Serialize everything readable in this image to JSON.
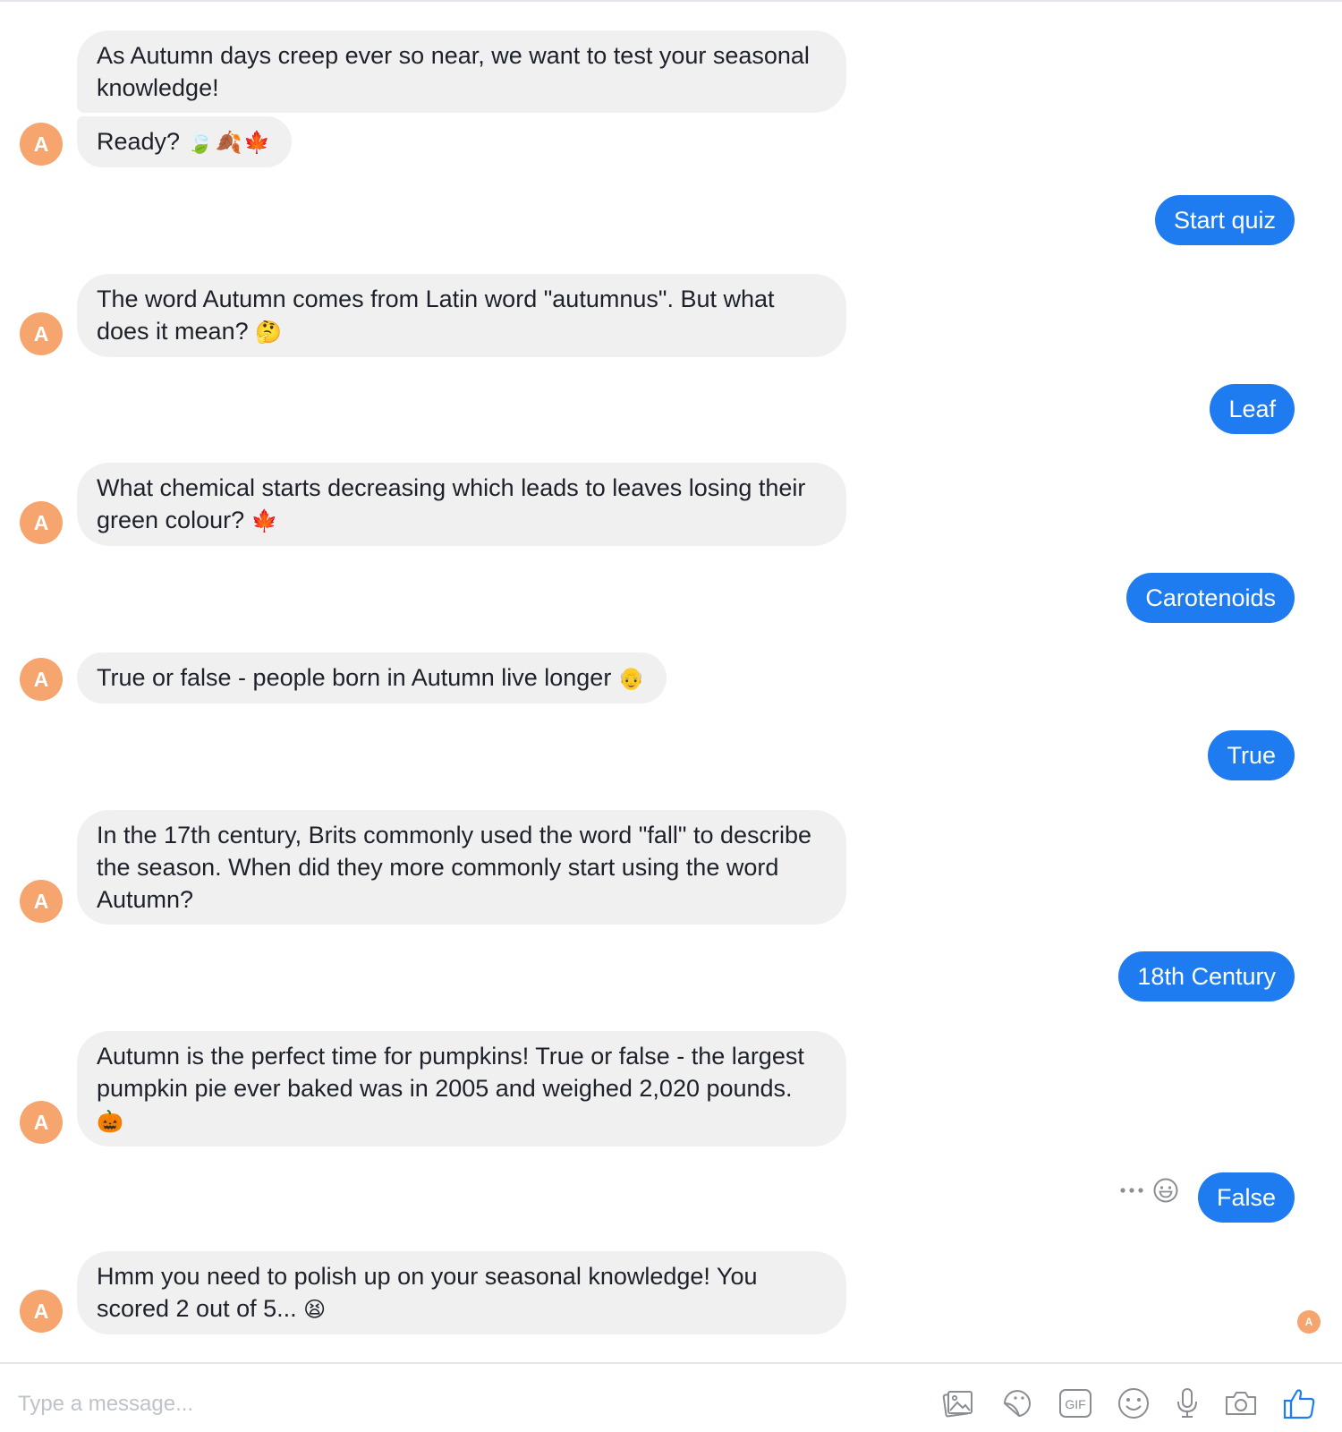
{
  "bot": {
    "avatar_letter": "A",
    "messages": [
      {
        "text": "As Autumn days creep ever so near, we want to test your seasonal knowledge!",
        "emoji": ""
      },
      {
        "text": "Ready?",
        "emoji": "🍃🍂🍁"
      },
      {
        "text": "The word Autumn comes from Latin word \"autumnus\". But what does it mean?",
        "emoji": "🤔"
      },
      {
        "text": "What chemical starts decreasing which leads to leaves losing their green colour?",
        "emoji": "🍁"
      },
      {
        "text": "True or false - people born in Autumn live longer",
        "emoji": "👴"
      },
      {
        "text": "In the 17th century, Brits commonly used the word \"fall\" to describe the season. When did they more commonly start using the word Autumn?",
        "emoji": ""
      },
      {
        "text": "Autumn is the perfect time for pumpkins! True or false - the largest pumpkin pie ever baked was in 2005 and weighed 2,020 pounds.",
        "emoji": "🎃"
      },
      {
        "text": "Hmm you need to polish up on your seasonal knowledge! You scored 2 out of 5...",
        "emoji": "😫"
      }
    ]
  },
  "user": {
    "replies": [
      "Start quiz",
      "Leaf",
      "Carotenoids",
      "True",
      "18th Century",
      "False"
    ]
  },
  "read_receipt_letter": "A",
  "composer": {
    "placeholder": "Type a message...",
    "value": "",
    "icons": [
      "gallery-icon",
      "sticker-icon",
      "gif-icon",
      "emoji-icon",
      "microphone-icon",
      "camera-icon",
      "thumbs-up-icon"
    ],
    "gif_label": "GIF"
  },
  "colors": {
    "bot_bubble": "#f1f0f0",
    "user_bubble": "#1e7cf0",
    "avatar": "#f5a56d",
    "composer_icons": "#8a8d91",
    "like_icon": "#1e7cf0"
  }
}
